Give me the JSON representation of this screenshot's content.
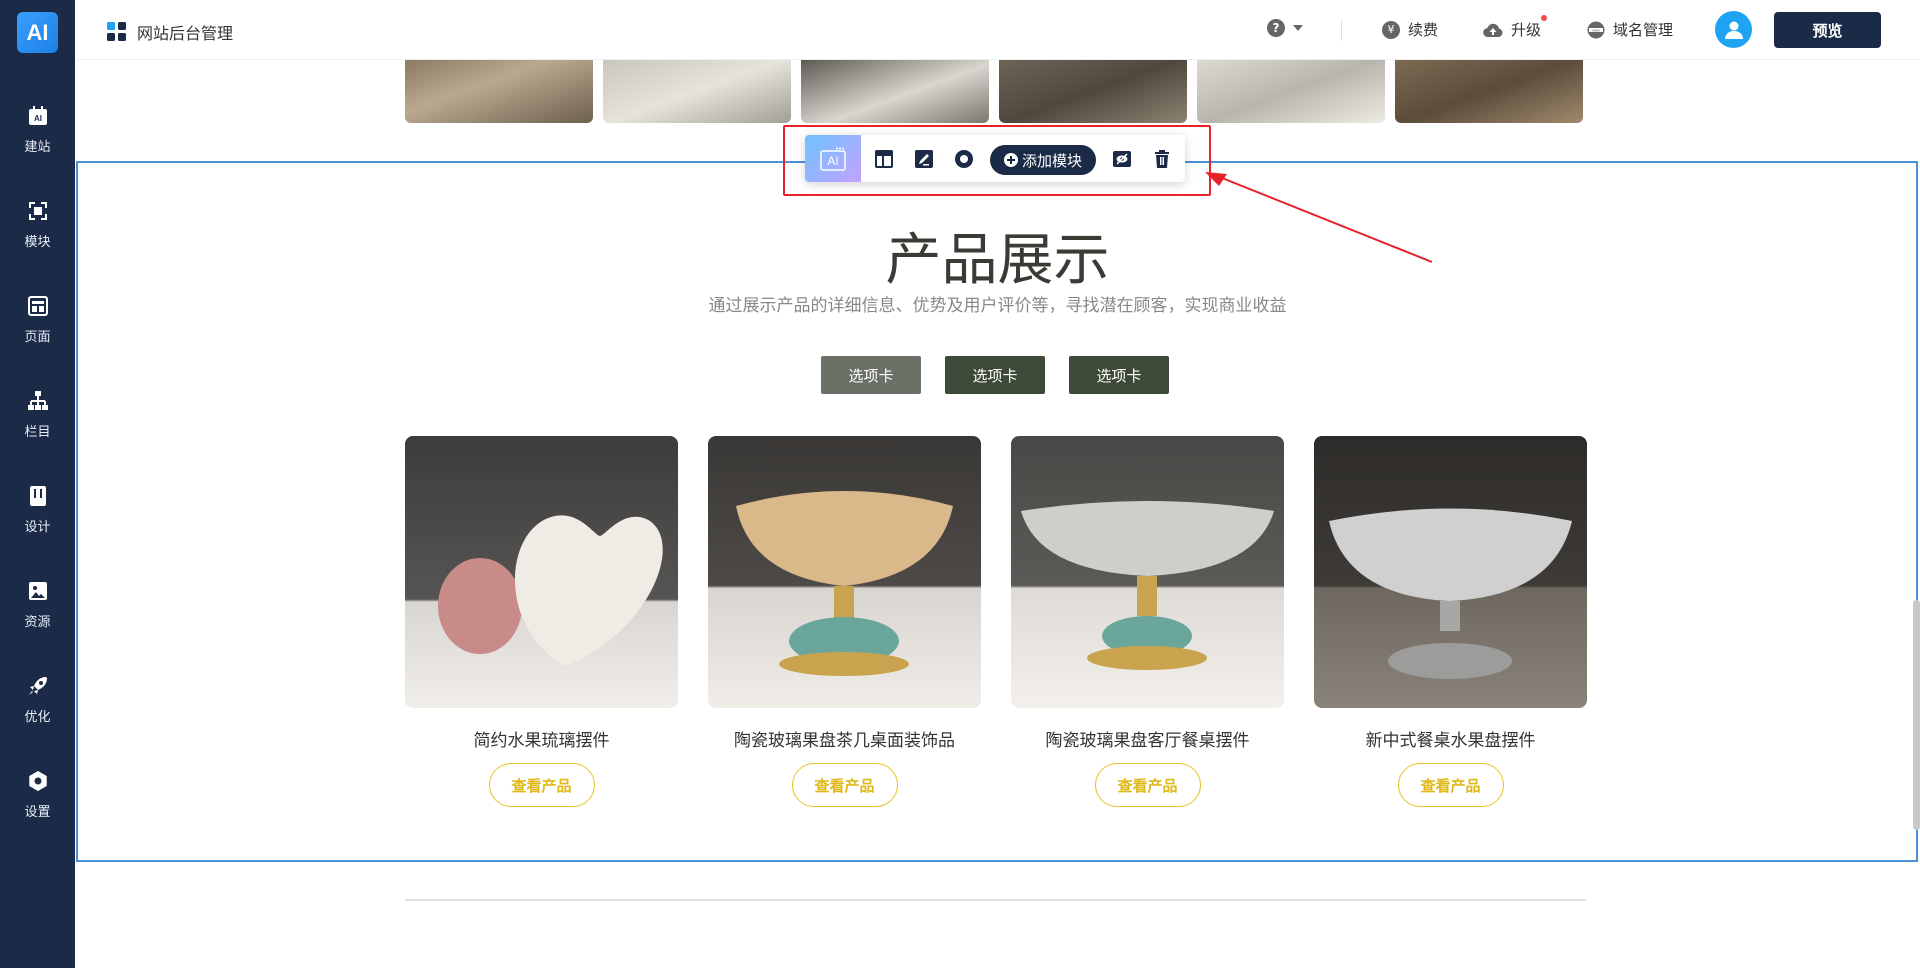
{
  "app": {
    "logo_text": "AI",
    "title": "网站后台管理"
  },
  "sidebar": {
    "items": [
      {
        "label": "建站",
        "icon": "ai-build-icon"
      },
      {
        "label": "模块",
        "icon": "module-icon"
      },
      {
        "label": "页面",
        "icon": "page-icon"
      },
      {
        "label": "栏目",
        "icon": "sitemap-icon"
      },
      {
        "label": "设计",
        "icon": "design-icon"
      },
      {
        "label": "资源",
        "icon": "image-icon"
      },
      {
        "label": "优化",
        "icon": "rocket-icon"
      },
      {
        "label": "设置",
        "icon": "gear-icon"
      }
    ]
  },
  "header": {
    "help_label": "?",
    "renew_label": "续费",
    "upgrade_label": "升级",
    "domain_label": "域名管理",
    "preview_label": "预览"
  },
  "toolbar": {
    "ai_label": "AI",
    "add_module_label": "添加模块"
  },
  "section": {
    "title": "产品展示",
    "subtitle": "通过展示产品的详细信息、优势及用户评价等，寻找潜在顾客，实现商业收益",
    "tabs": [
      "选项卡",
      "选项卡",
      "选项卡"
    ]
  },
  "products": [
    {
      "name": "简约水果琉璃摆件",
      "button": "查看产品"
    },
    {
      "name": "陶瓷玻璃果盘茶几桌面装饰品",
      "button": "查看产品"
    },
    {
      "name": "陶瓷玻璃果盘客厅餐桌摆件",
      "button": "查看产品"
    },
    {
      "name": "新中式餐桌水果盘摆件",
      "button": "查看产品"
    }
  ],
  "colors": {
    "sidebar_bg": "#1b2a47",
    "accent_blue": "#4a90d9",
    "highlight_red": "#e8222a",
    "product_button": "#e0b818",
    "tab_active": "#6b7167",
    "tab_inactive": "#3d4a37"
  }
}
